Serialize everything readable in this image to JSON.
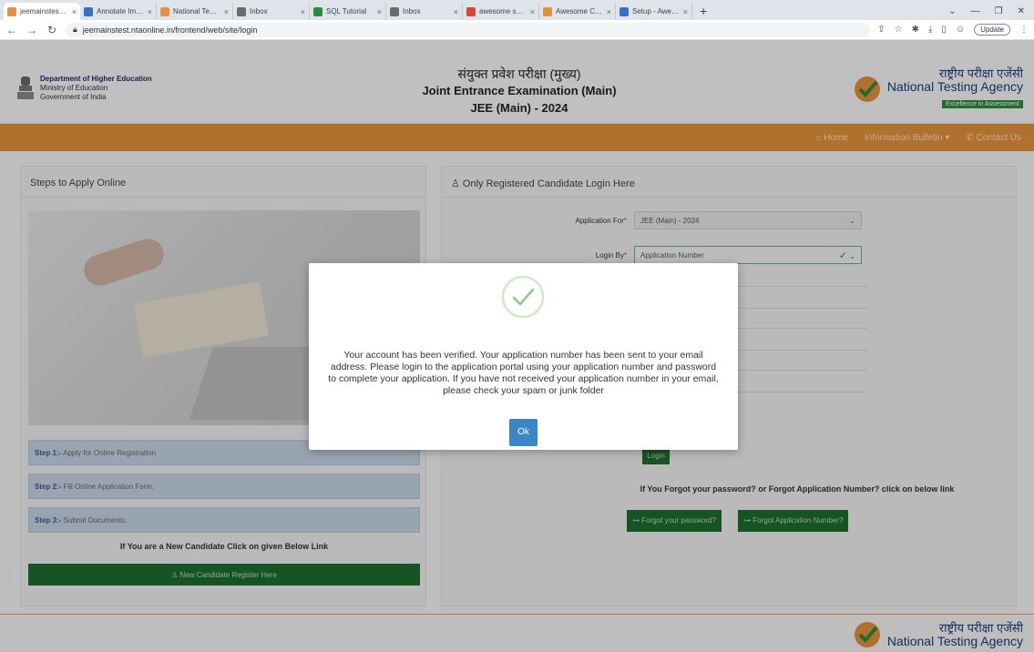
{
  "browser": {
    "tabs": [
      {
        "title": "jeemainstest.ntaonli",
        "fav_color": "#e2913c",
        "active": true
      },
      {
        "title": "Annotate Image",
        "fav_color": "#3b6fc4",
        "active": false
      },
      {
        "title": "National Testing Age",
        "fav_color": "#e2913c",
        "active": false
      },
      {
        "title": "Inbox",
        "fav_color": "#6b6b6b",
        "active": false
      },
      {
        "title": "SQL Tutorial",
        "fav_color": "#2e8b3e",
        "active": false
      },
      {
        "title": "Inbox",
        "fav_color": "#6b6b6b",
        "active": false
      },
      {
        "title": "awesome screenshot",
        "fav_color": "#d44638",
        "active": false
      },
      {
        "title": "Awesome ChatGPT",
        "fav_color": "#e2913c",
        "active": false
      },
      {
        "title": "Setup - Awesome S",
        "fav_color": "#3b6fc4",
        "active": false
      }
    ],
    "close_glyph": "×",
    "new_tab_glyph": "+",
    "url": "jeemainstest.ntaonline.in/frontend/web/site/login",
    "update_label": "Update"
  },
  "header": {
    "dept_line1": "Department of Higher Education",
    "dept_line2": "Ministry of Education",
    "dept_line3": "Government of India",
    "title_hindi": "संयुक्त प्रवेश परीक्षा (मुख्य)",
    "title_en": "Joint Entrance Examination (Main)",
    "title_year": "JEE (Main) - 2024",
    "nta_hindi": "राष्ट्रीय परीक्षा एजेंसी",
    "nta_en": "National Testing Agency",
    "nta_tag": "Excellence in Assessment"
  },
  "nav": {
    "home": "⌂ Home",
    "bulletin": "Information Bulletin ▾",
    "contact": "✆ Contact Us"
  },
  "left_panel": {
    "heading": "Steps to Apply Online",
    "steps": [
      {
        "num": "Step 1:-",
        "text": " Apply for Online Registration"
      },
      {
        "num": "Step 2:-",
        "text": " Fill Online Application Form."
      },
      {
        "num": "Step 3:-",
        "text": " Submit Documents."
      }
    ],
    "new_candidate_text": "If You are a New Candidate Click on given Below Link",
    "register_label": "♙ New Candidate Register Here"
  },
  "right_panel": {
    "heading": "♙ Only Registered Candidate Login Here",
    "app_for_label": "Application For",
    "app_for_value": "JEE (Main) - 2024",
    "login_by_label": "Login By",
    "login_by_value": "Application Number",
    "required_mark": "*",
    "login_label": "Login",
    "forgot_text": "If You Forgot your password? or Forgot Application Number? click on below link",
    "forgot_password_label": "⊶ Forgot your password?",
    "forgot_appno_label": "⊶ Forgot Application Number?"
  },
  "modal": {
    "message": "Your account has been verified. Your application number has been sent to your email address. Please login to the application portal using your application number and password to complete your application. If you have not received your application number in your email, please check your spam or junk folder",
    "ok_label": "Ok"
  },
  "colors": {
    "orange": "#e2913c",
    "green": "#1d6c2d",
    "ok_blue": "#3a86c6",
    "check_green": "#8fc98a"
  }
}
